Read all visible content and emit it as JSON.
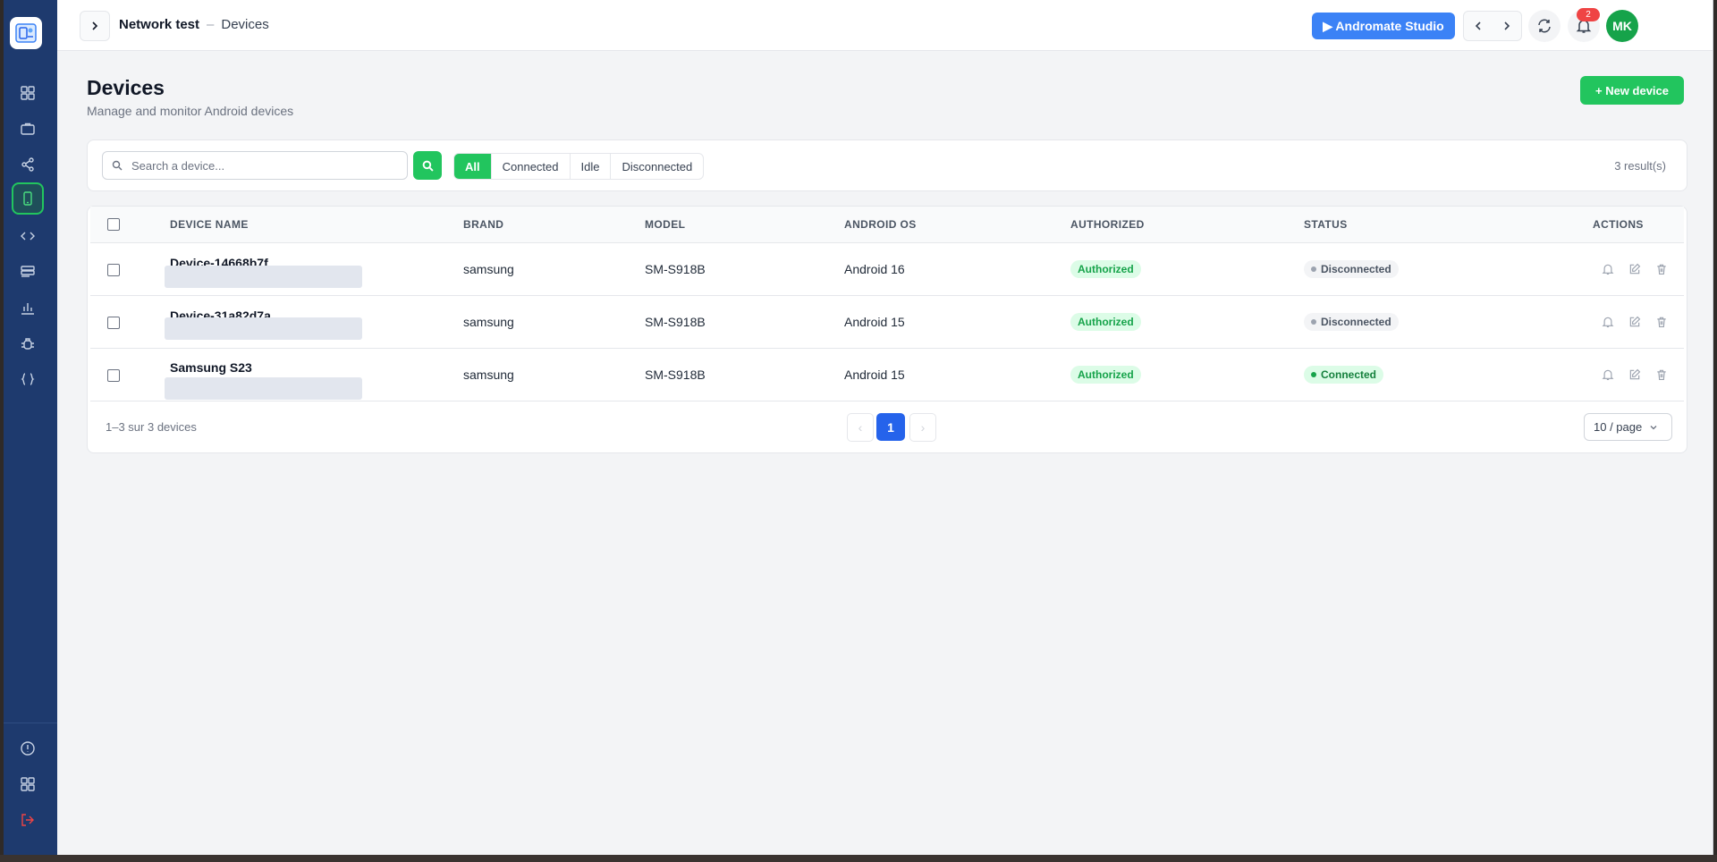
{
  "header": {
    "project": "Network test",
    "separator": "–",
    "page": "Devices",
    "studio_button": "▶ Andromate Studio",
    "notification_count": "2",
    "avatar_initials": "MK"
  },
  "sidebar": {
    "items": [
      {
        "icon": "dashboard-icon"
      },
      {
        "icon": "briefcase-icon"
      },
      {
        "icon": "share-icon"
      },
      {
        "icon": "device-icon",
        "active": true
      },
      {
        "icon": "code-icon"
      },
      {
        "icon": "database-icon"
      },
      {
        "icon": "chart-icon"
      },
      {
        "icon": "bug-icon"
      },
      {
        "icon": "braces-icon"
      }
    ],
    "bottom": [
      {
        "icon": "info-icon"
      },
      {
        "icon": "apps-icon"
      },
      {
        "icon": "logout-icon"
      }
    ]
  },
  "page": {
    "title": "Devices",
    "subtitle": "Manage and monitor Android devices",
    "new_button": "+ New device"
  },
  "search": {
    "placeholder": "Search a device...",
    "value": ""
  },
  "filters": [
    "All",
    "Connected",
    "Idle",
    "Disconnected"
  ],
  "selected_filter": "All",
  "results": "3 result(s)",
  "table": {
    "columns": [
      "DEVICE NAME",
      "BRAND",
      "MODEL",
      "ANDROID OS",
      "AUTHORIZED",
      "STATUS",
      "ACTIONS"
    ],
    "rows": [
      {
        "name": "Device-14668b7f",
        "brand": "samsung",
        "model": "SM-S918B",
        "os": "Android 16",
        "authorized": "Authorized",
        "status": "Disconnected"
      },
      {
        "name": "Device-31a82d7a",
        "brand": "samsung",
        "model": "SM-S918B",
        "os": "Android 15",
        "authorized": "Authorized",
        "status": "Disconnected"
      },
      {
        "name": "Samsung S23",
        "brand": "samsung",
        "model": "SM-S918B",
        "os": "Android 15",
        "authorized": "Authorized",
        "status": "Connected"
      }
    ]
  },
  "pagination": {
    "summary": "1–3 sur 3 devices",
    "prev": "‹",
    "current": "1",
    "next": "›",
    "per_page": "10 / page"
  },
  "colors": {
    "sidebar": "#1e3a6e",
    "accent_green": "#22c55e",
    "primary_blue": "#3b82f6",
    "danger": "#ef4444"
  }
}
